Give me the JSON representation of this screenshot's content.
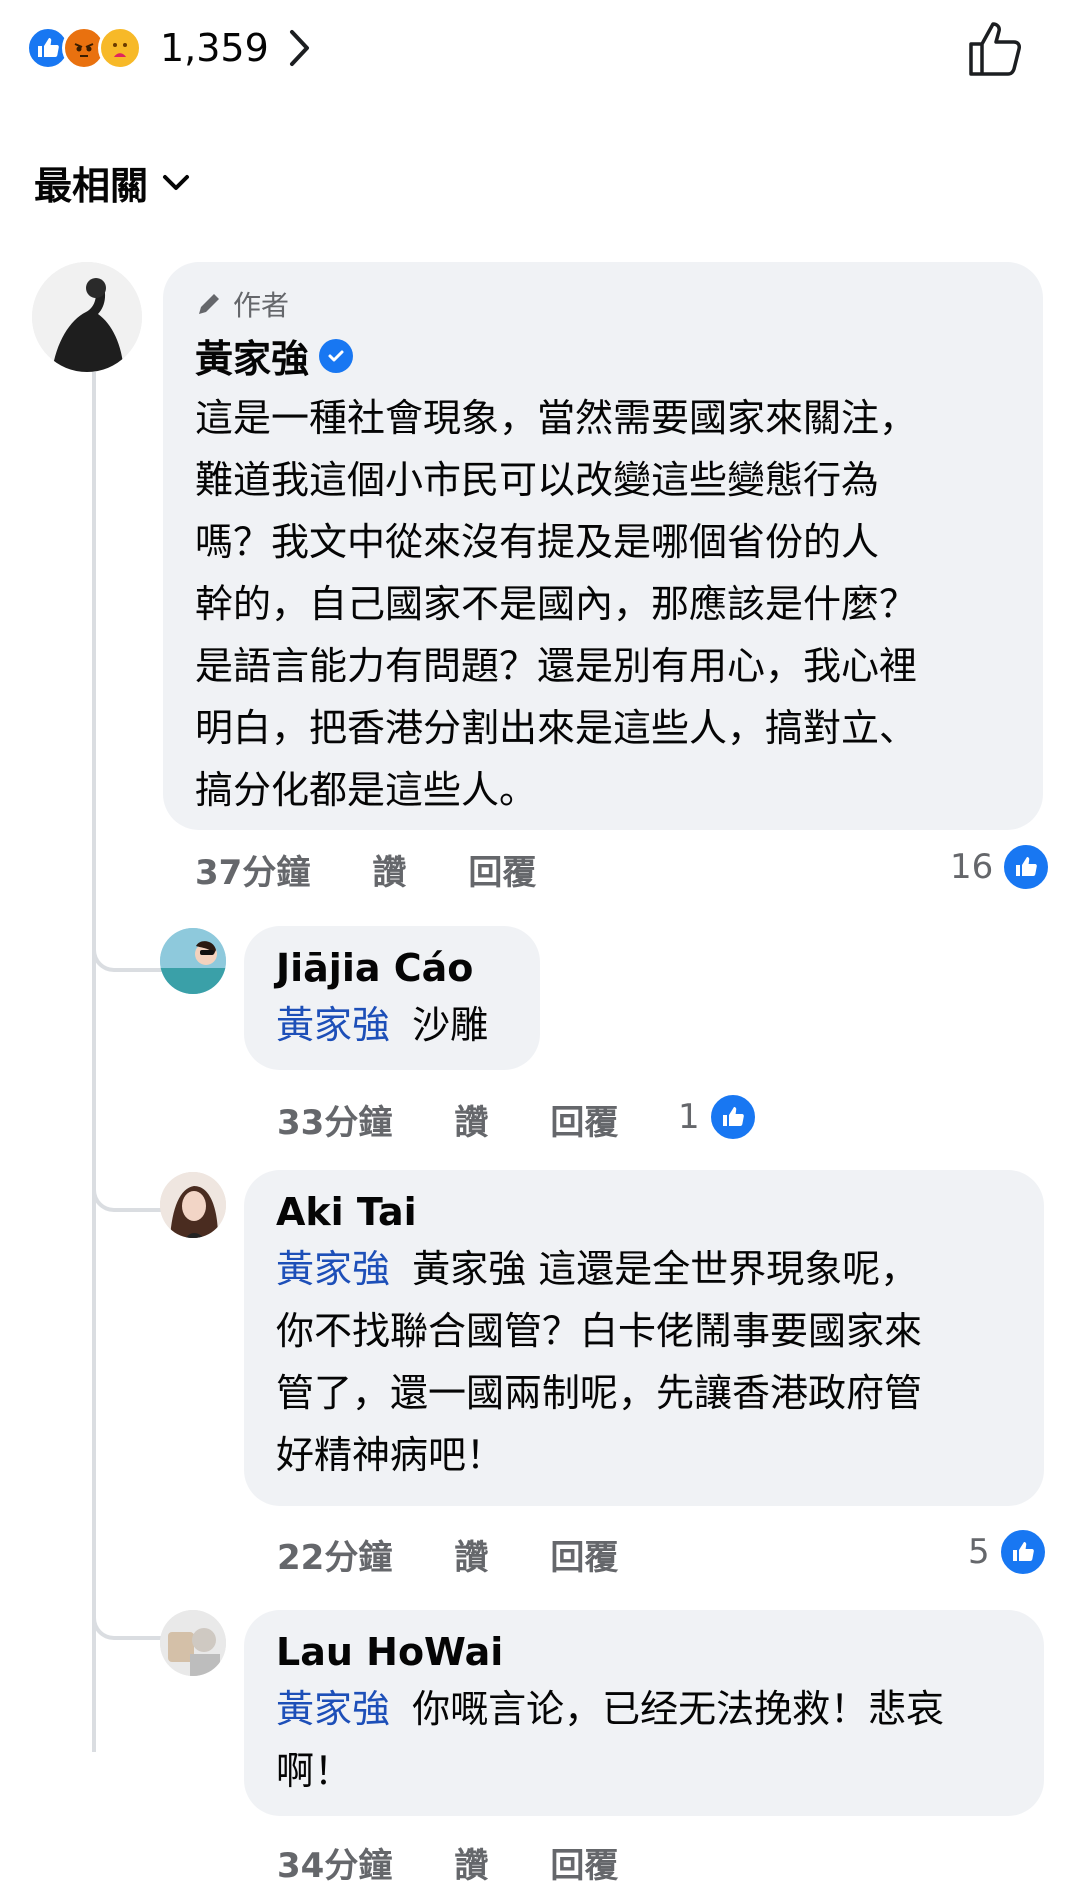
{
  "reactions": {
    "count": "1,359",
    "types": [
      "like-icon",
      "angry-icon",
      "care-icon"
    ],
    "colors": {
      "like": "#1877f2",
      "angry": "#e9710f",
      "care": "#f7b928"
    }
  },
  "sort": {
    "label": "最相關"
  },
  "comments": [
    {
      "author_tag": "作者",
      "name": "黃家強",
      "text": "這是一種社會現象，當然需要國家來關注，難道我這個小市民可以改變這些變態行為嗎？我文中從來沒有提及是哪個省份的人幹的，自己國家不是國內，那應該是什麼？是語言能力有問題？還是別有用心，我心裡明白，把香港分割出來是這些人，搞對立、搞分化都是這些人。",
      "lines": [
        "這是一種社會現象，當然需要國家來關注，",
        "難道我這個小市民可以改變這些變態行為",
        "嗎？我文中從來沒有提及是哪個省份的人",
        "幹的，自己國家不是國內，那應該是什麼？",
        "是語言能力有問題？還是別有用心，我心裡",
        "明白，把香港分割出來是這些人，搞對立、",
        "搞分化都是這些人。"
      ],
      "time": "37分鐘",
      "like_label": "讚",
      "reply_label": "回覆",
      "reaction_count": "16"
    }
  ],
  "replies": [
    {
      "name": "Jiājia Cáo",
      "mention": "黃家強",
      "lines": [
        "沙雕"
      ],
      "time": "33分鐘",
      "like_label": "讚",
      "reply_label": "回覆",
      "reaction_count": "1"
    },
    {
      "name": "Aki Tai",
      "mention": "黃家強",
      "lines": [
        "黃家強 這還是全世界現象呢，",
        "你不找聯合國管？白卡佬鬧事要國家來",
        "管了，還一國兩制呢，先讓香港政府管",
        "好精神病吧！"
      ],
      "time": "22分鐘",
      "like_label": "讚",
      "reply_label": "回覆",
      "reaction_count": "5"
    },
    {
      "name": "Lau HoWai",
      "mention": "黃家強",
      "lines": [
        "你嘅言论，已经无法挽救！悲哀",
        "啊！"
      ],
      "time": "34分鐘",
      "like_label": "讚",
      "reply_label": "回覆"
    }
  ]
}
